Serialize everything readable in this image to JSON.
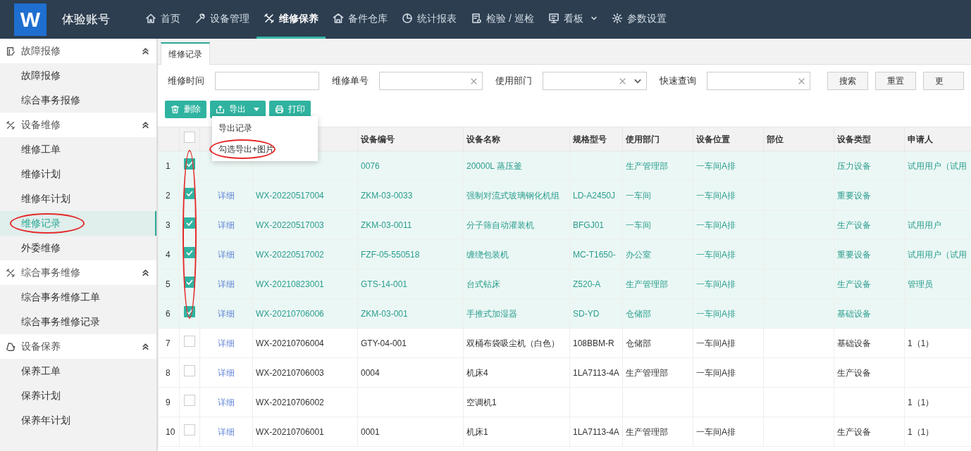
{
  "header": {
    "logo": "W",
    "account": "体验账号",
    "nav": [
      {
        "label": "首页",
        "selected": false
      },
      {
        "label": "设备管理",
        "selected": false
      },
      {
        "label": "维修保养",
        "selected": true
      },
      {
        "label": "备件仓库",
        "selected": false
      },
      {
        "label": "统计报表",
        "selected": false
      },
      {
        "label": "检验 / 巡检",
        "selected": false
      },
      {
        "label": "看板",
        "selected": false,
        "dropdown": true
      },
      {
        "label": "参数设置",
        "selected": false
      }
    ]
  },
  "sidebar": {
    "groups": [
      {
        "label": "故障报修",
        "expanded": true,
        "items": [
          {
            "label": "故障报修",
            "selected": false
          },
          {
            "label": "综合事务报修",
            "selected": false
          }
        ]
      },
      {
        "label": "设备维修",
        "expanded": true,
        "items": [
          {
            "label": "维修工单",
            "selected": false
          },
          {
            "label": "维修计划",
            "selected": false
          },
          {
            "label": "维修年计划",
            "selected": false
          },
          {
            "label": "维修记录",
            "selected": true,
            "circled": true
          },
          {
            "label": "外委维修",
            "selected": false
          }
        ]
      },
      {
        "label": "综合事务维修",
        "expanded": true,
        "items": [
          {
            "label": "综合事务维修工单",
            "selected": false
          },
          {
            "label": "综合事务维修记录",
            "selected": false
          }
        ]
      },
      {
        "label": "设备保养",
        "expanded": true,
        "items": [
          {
            "label": "保养工单",
            "selected": false
          },
          {
            "label": "保养计划",
            "selected": false
          },
          {
            "label": "保养年计划",
            "selected": false
          }
        ]
      }
    ]
  },
  "tabs": [
    {
      "label": "维修记录",
      "selected": true
    }
  ],
  "filters": [
    {
      "label": "维修时间",
      "clear": false,
      "select": false
    },
    {
      "label": "维修单号",
      "clear": true,
      "select": false
    },
    {
      "label": "使用部门",
      "clear": true,
      "select": true
    },
    {
      "label": "快速查询",
      "clear": true,
      "select": false
    }
  ],
  "filter_buttons": [
    "搜索",
    "重置",
    "更"
  ],
  "actions": [
    {
      "kind": "delete",
      "label": "删除"
    },
    {
      "kind": "export",
      "label": "导出",
      "dropdown": true
    },
    {
      "kind": "print",
      "label": "打印"
    }
  ],
  "export_menu": {
    "open": true,
    "items": [
      {
        "label": "导出记录",
        "circled": false
      },
      {
        "label": "勾选导出+图片",
        "circled": true
      }
    ]
  },
  "table": {
    "checkbox_column_circled": true,
    "select_all": false,
    "columns": [
      "设备编号",
      "设备名称",
      "规格型号",
      "使用部门",
      "设备位置",
      "部位",
      "设备类型",
      "申请人"
    ],
    "rows": [
      {
        "no": "1",
        "checked": true,
        "cells": [
          "0076",
          "20000L 蒸压釜",
          null,
          "生产管理部",
          "一车间A排",
          null,
          "压力设备",
          "试用用户（试用"
        ]
      },
      {
        "no": "2",
        "checked": true,
        "link": "详细",
        "order_no": "WX-20220517004",
        "cells": [
          "ZKM-03-0033",
          "强制对流式玻璃钢化机组",
          "LD-A2450J",
          "一车间",
          "一车间A排",
          null,
          "重要设备",
          null
        ]
      },
      {
        "no": "3",
        "checked": true,
        "link": "详细",
        "order_no": "WX-20220517003",
        "cells": [
          "ZKM-03-0011",
          "分子筛自动灌装机",
          "BFGJ01",
          "一车间",
          "一车间A排",
          null,
          "生产设备",
          "试用用户"
        ]
      },
      {
        "no": "4",
        "checked": true,
        "link": "详细",
        "order_no": "WX-20220517002",
        "cells": [
          "FZF-05-550518",
          "缠绕包装机",
          "MC-T1650-",
          "办公室",
          "一车间A排",
          null,
          "重要设备",
          "试用用户（试用"
        ]
      },
      {
        "no": "5",
        "checked": true,
        "link": "详细",
        "order_no": "WX-20210823001",
        "cells": [
          "GTS-14-001",
          "台式钻床",
          "Z520-A",
          "生产管理部",
          "一车间A排",
          null,
          "生产设备",
          "管理员"
        ]
      },
      {
        "no": "6",
        "checked": true,
        "link": "详细",
        "order_no": "WX-20210706006",
        "cells": [
          "ZKM-03-001",
          "手推式加湿器",
          "SD-YD",
          "仓储部",
          "一车间A排",
          null,
          "基础设备",
          null
        ]
      },
      {
        "no": "7",
        "checked": false,
        "link": "详细",
        "order_no": "WX-20210706004",
        "cells": [
          "GTY-04-001",
          "双桶布袋吸尘机（白色）",
          "108BBM-R",
          "仓储部",
          "一车间A排",
          null,
          "基础设备",
          "1（1）"
        ]
      },
      {
        "no": "8",
        "checked": false,
        "link": "详细",
        "order_no": "WX-20210706003",
        "cells": [
          "0004",
          "机床4",
          "1LA7113-4A",
          "生产管理部",
          "一车间A排",
          null,
          "生产设备",
          null
        ]
      },
      {
        "no": "9",
        "checked": false,
        "link": "详细",
        "order_no": "WX-20210706002",
        "cells": [
          null,
          "空调机1",
          null,
          null,
          null,
          null,
          null,
          "1（1）"
        ]
      },
      {
        "no": "10",
        "checked": false,
        "link": "详细",
        "order_no": "WX-20210706001",
        "cells": [
          "0001",
          "机床1",
          "1LA7113-4A",
          "生产管理部",
          "一车间A排",
          null,
          "生产设备",
          "1（1）"
        ]
      }
    ]
  }
}
